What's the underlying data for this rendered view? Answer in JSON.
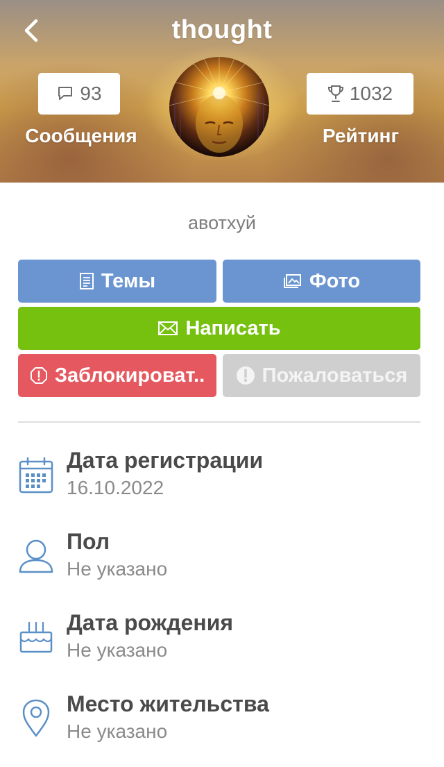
{
  "header": {
    "title": "thought",
    "messages": {
      "count": "93",
      "label": "Сообщения"
    },
    "rating": {
      "count": "1032",
      "label": "Рейтинг"
    }
  },
  "profile": {
    "status_text": "авотхуй"
  },
  "actions": {
    "topics_label": "Темы",
    "photo_label": "Фото",
    "write_label": "Написать",
    "block_label": "Заблокироват..",
    "report_label": "Пожаловаться"
  },
  "info": [
    {
      "title": "Дата регистрации",
      "value": "16.10.2022",
      "icon": "calendar-icon"
    },
    {
      "title": "Пол",
      "value": "Не указано",
      "icon": "user-icon"
    },
    {
      "title": "Дата рождения",
      "value": "Не указано",
      "icon": "cake-icon"
    },
    {
      "title": "Место жительства",
      "value": "Не указано",
      "icon": "location-pin-icon"
    }
  ],
  "colors": {
    "accent_blue": "#6b95d1",
    "write_green": "#76c00f",
    "block_red": "#e5585f",
    "report_gray": "#cfcfcf",
    "icon_blue": "#5a8fc7"
  }
}
